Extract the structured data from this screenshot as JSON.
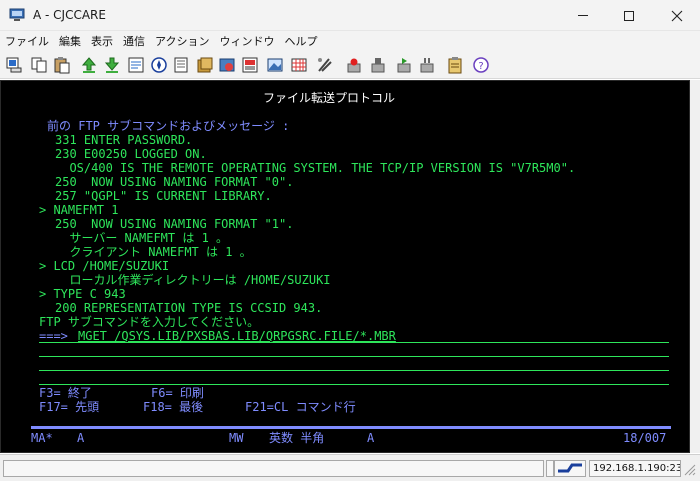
{
  "window": {
    "title": "A - CJCCARE"
  },
  "menu": [
    "ファイル",
    "編集",
    "表示",
    "通信",
    "アクション",
    "ウィンドウ",
    "ヘルプ"
  ],
  "toolbar_icons": [
    "copy-screen-icon",
    "copy-icon",
    "paste-icon",
    "send-file-icon",
    "receive-file-icon",
    "properties-icon",
    "navigator-icon",
    "notes-icon",
    "macro-icon",
    "session-config-icon",
    "print-screen-icon",
    "image-icon",
    "keypad-icon",
    "edit-tools-icon",
    "record-icon",
    "stop-icon",
    "play-icon",
    "pause-icon",
    "clipboard-icon",
    "help-icon"
  ],
  "terminal": {
    "screen_title": "ファイル転送プロトコル",
    "heading": "前の FTP サブコマンドおよびメッセージ :",
    "messages": [
      {
        "text": "331 ENTER PASSWORD.",
        "color": "green"
      },
      {
        "text": "230 E00250 LOGGED ON.",
        "color": "green"
      },
      {
        "text": "  OS/400 IS THE REMOTE OPERATING SYSTEM. THE TCP/IP VERSION IS \"V7R5M0\".",
        "color": "green"
      },
      {
        "text": "250  NOW USING NAMING FORMAT \"0\".",
        "color": "green"
      },
      {
        "text": "257 \"QGPL\" IS CURRENT LIBRARY.",
        "color": "green"
      },
      {
        "text": "> NAMEFMT 1",
        "color": "green"
      },
      {
        "text": "250  NOW USING NAMING FORMAT \"1\".",
        "color": "green"
      },
      {
        "text": "  サーバー NAMEFMT は 1 。",
        "color": "green"
      },
      {
        "text": "  クライアント NAMEFMT は 1 。",
        "color": "green"
      },
      {
        "text": "> LCD /HOME/SUZUKI",
        "color": "green"
      },
      {
        "text": "  ローカル作業ディレクトリーは /HOME/SUZUKI",
        "color": "green"
      },
      {
        "text": "> TYPE C 943",
        "color": "green"
      },
      {
        "text": "200 REPRESENTATION TYPE IS CCSID 943.",
        "color": "green"
      }
    ],
    "prompt": "FTP サブコマンドを入力してください。",
    "arrow": "===>",
    "command": "MGET /QSYS.LIB/PXSBAS.LIB/QRPGSRC.FILE/*.MBR",
    "function_keys_1": [
      "F3= 終了",
      "F6= 印刷"
    ],
    "function_keys_2": [
      "F17= 先頭",
      "F18= 最後",
      "F21=CL コマンド行"
    ],
    "oia": {
      "mode": "MA*",
      "session": "A",
      "mw": "MW",
      "input_mode": "英数 半角",
      "session2": "A",
      "cursor_pos": "18/007"
    }
  },
  "statusbar": {
    "ip": "192.168.1.190:23"
  },
  "colors": {
    "terminal_bg": "#000000",
    "white": "#ffffff",
    "blue": "#7f8cff",
    "green": "#2ee65b"
  }
}
